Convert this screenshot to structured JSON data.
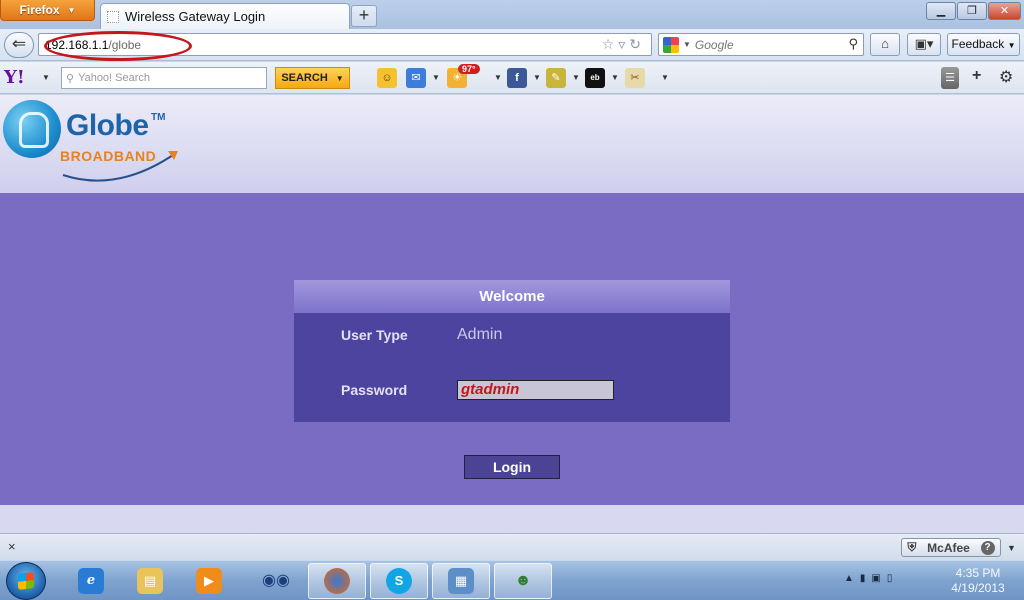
{
  "browser": {
    "menu_label": "Firefox",
    "tab_title": "Wireless Gateway Login",
    "new_tab_label": "+",
    "url_host": "192.168.1.1",
    "url_path": "/globe",
    "search_engine": "Google",
    "search_placeholder": "Google",
    "feedback_label": "Feedback"
  },
  "yahoo_toolbar": {
    "logo_text": "Y!",
    "search_placeholder": "Yahoo! Search",
    "search_button": "SEARCH",
    "weather_badge": "97°",
    "icons": [
      "smiley-icon",
      "mail-icon",
      "weather-icon",
      "facebook-icon",
      "notes-icon",
      "ebay-icon",
      "puzzle-icon"
    ]
  },
  "page": {
    "logo_name": "Globe",
    "logo_tm": "TM",
    "logo_sub": "BROADBAND",
    "welcome": "Welcome",
    "user_type_label": "User Type",
    "user_type_value": "Admin",
    "password_label": "Password",
    "password_value": "gtadmin",
    "login_button": "Login"
  },
  "addon_bar": {
    "close": "×",
    "mcafee_label": "McAfee",
    "help": "?"
  },
  "taskbar": {
    "apps": [
      "internet-explorer",
      "windows-explorer",
      "media-player",
      "eyes-app",
      "firefox",
      "skype",
      "control-panel",
      "network-people"
    ],
    "active_app": "firefox",
    "time": "4:35 PM",
    "date": "4/19/2013"
  },
  "colors": {
    "page_band": "#7a6cc2",
    "card": "#4d44a0",
    "password_text": "#c3171b",
    "annotation_circle": "#c3171b"
  }
}
